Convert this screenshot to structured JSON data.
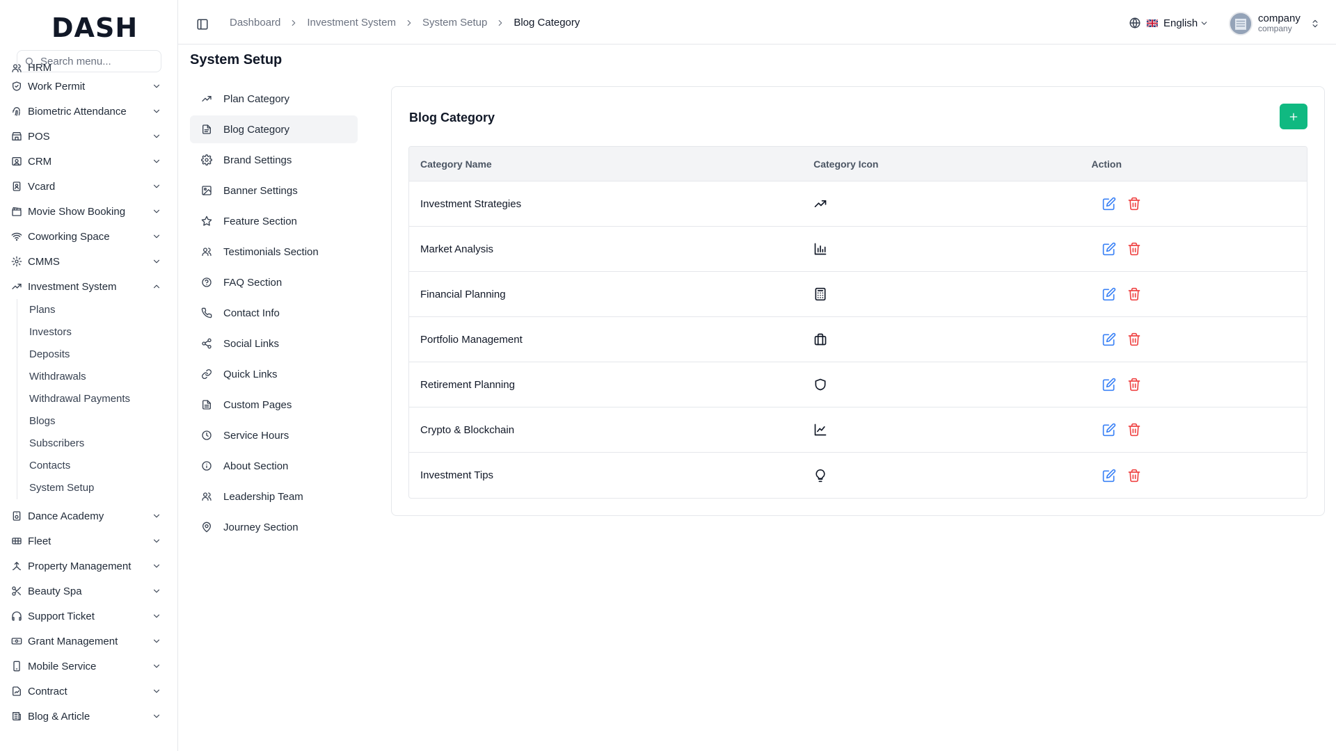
{
  "brand": {
    "logo_text": "DASH"
  },
  "search": {
    "placeholder": "Search menu..."
  },
  "sidebar": {
    "items": [
      {
        "label": "HRM",
        "icon": "users-icon"
      },
      {
        "label": "Work Permit",
        "icon": "shield-check-icon"
      },
      {
        "label": "Biometric Attendance",
        "icon": "fingerprint-icon"
      },
      {
        "label": "POS",
        "icon": "store-icon"
      },
      {
        "label": "CRM",
        "icon": "contact-icon"
      },
      {
        "label": "Vcard",
        "icon": "id-card-icon"
      },
      {
        "label": "Movie Show Booking",
        "icon": "clapper-icon"
      },
      {
        "label": "Coworking Space",
        "icon": "wifi-icon"
      },
      {
        "label": "CMMS",
        "icon": "cog-icon"
      },
      {
        "label": "Investment System",
        "icon": "trending-up-icon",
        "expanded": true
      }
    ],
    "submenu": [
      "Plans",
      "Investors",
      "Deposits",
      "Withdrawals",
      "Withdrawal Payments",
      "Blogs",
      "Subscribers",
      "Contacts",
      "System Setup"
    ],
    "items_after": [
      {
        "label": "Dance Academy",
        "icon": "music-icon"
      },
      {
        "label": "Fleet",
        "icon": "truck-icon"
      },
      {
        "label": "Property Management",
        "icon": "home-icon"
      },
      {
        "label": "Beauty Spa",
        "icon": "scissors-icon"
      },
      {
        "label": "Support Ticket",
        "icon": "headphones-icon"
      },
      {
        "label": "Grant Management",
        "icon": "banknote-icon"
      },
      {
        "label": "Mobile Service",
        "icon": "smartphone-icon"
      },
      {
        "label": "Contract",
        "icon": "file-signature-icon"
      },
      {
        "label": "Blog & Article",
        "icon": "newspaper-icon"
      }
    ]
  },
  "breadcrumb": [
    "Dashboard",
    "Investment System",
    "System Setup",
    "Blog Category"
  ],
  "language": {
    "label": "English"
  },
  "user": {
    "name": "company",
    "role": "company"
  },
  "page": {
    "title": "System Setup"
  },
  "setup_nav": [
    {
      "label": "Plan Category",
      "icon": "trending-up-icon"
    },
    {
      "label": "Blog Category",
      "icon": "file-text-icon",
      "active": true
    },
    {
      "label": "Brand Settings",
      "icon": "settings-icon"
    },
    {
      "label": "Banner Settings",
      "icon": "image-icon"
    },
    {
      "label": "Feature Section",
      "icon": "star-icon"
    },
    {
      "label": "Testimonials Section",
      "icon": "users-icon"
    },
    {
      "label": "FAQ Section",
      "icon": "help-circle-icon"
    },
    {
      "label": "Contact Info",
      "icon": "phone-icon"
    },
    {
      "label": "Social Links",
      "icon": "share-icon"
    },
    {
      "label": "Quick Links",
      "icon": "link-icon"
    },
    {
      "label": "Custom Pages",
      "icon": "file-icon"
    },
    {
      "label": "Service Hours",
      "icon": "clock-icon"
    },
    {
      "label": "About Section",
      "icon": "info-icon"
    },
    {
      "label": "Leadership Team",
      "icon": "users-icon"
    },
    {
      "label": "Journey Section",
      "icon": "map-pin-icon"
    }
  ],
  "card": {
    "title": "Blog Category",
    "columns": [
      "Category Name",
      "Category Icon",
      "Action"
    ],
    "rows": [
      {
        "name": "Investment Strategies",
        "icon": "trending-up-icon"
      },
      {
        "name": "Market Analysis",
        "icon": "bar-chart-icon"
      },
      {
        "name": "Financial Planning",
        "icon": "calculator-icon"
      },
      {
        "name": "Portfolio Management",
        "icon": "briefcase-icon"
      },
      {
        "name": "Retirement Planning",
        "icon": "shield-icon"
      },
      {
        "name": "Crypto & Blockchain",
        "icon": "line-chart-icon"
      },
      {
        "name": "Investment Tips",
        "icon": "lightbulb-icon"
      }
    ]
  },
  "colors": {
    "accent": "#10b981",
    "edit": "#3b82f6",
    "delete": "#ef4444"
  }
}
